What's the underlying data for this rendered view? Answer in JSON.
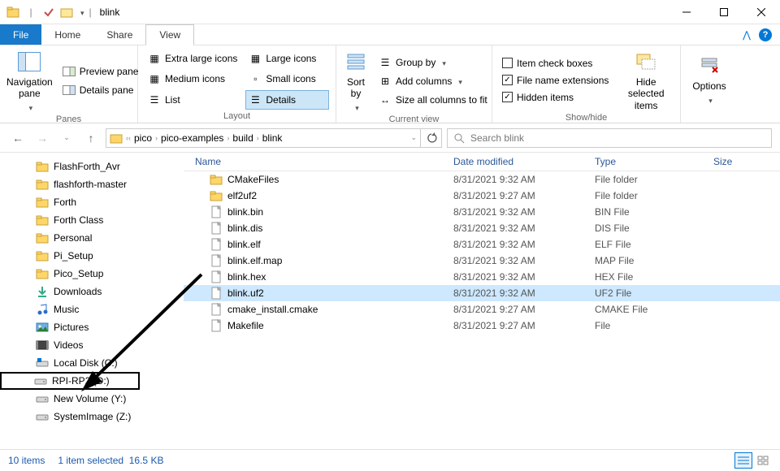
{
  "window": {
    "title": "blink"
  },
  "menubar": {
    "file": "File",
    "tabs": [
      "Home",
      "Share",
      "View"
    ],
    "active": 2
  },
  "ribbon": {
    "panes": {
      "label": "Panes",
      "nav": "Navigation pane",
      "preview": "Preview pane",
      "details": "Details pane"
    },
    "layout": {
      "label": "Layout",
      "xl": "Extra large icons",
      "lg": "Large icons",
      "md": "Medium icons",
      "sm": "Small icons",
      "list": "List",
      "details": "Details"
    },
    "current": {
      "label": "Current view",
      "sort": "Sort by",
      "group": "Group by",
      "addcols": "Add columns",
      "sizecols": "Size all columns to fit"
    },
    "showhide": {
      "label": "Show/hide",
      "itemcheck": "Item check boxes",
      "fileext": "File name extensions",
      "hidden": "Hidden items",
      "hidesel": "Hide selected items"
    },
    "options": "Options"
  },
  "breadcrumbs": [
    "pico",
    "pico-examples",
    "build",
    "blink"
  ],
  "search": {
    "placeholder": "Search blink"
  },
  "tree": [
    {
      "name": "FlashForth_Avr",
      "icon": "folder"
    },
    {
      "name": "flashforth-master",
      "icon": "folder"
    },
    {
      "name": "Forth",
      "icon": "folder"
    },
    {
      "name": "Forth Class",
      "icon": "folder"
    },
    {
      "name": "Personal",
      "icon": "folder"
    },
    {
      "name": "Pi_Setup",
      "icon": "folder"
    },
    {
      "name": "Pico_Setup",
      "icon": "folder"
    },
    {
      "name": "Downloads",
      "icon": "downloads"
    },
    {
      "name": "Music",
      "icon": "music"
    },
    {
      "name": "Pictures",
      "icon": "pictures"
    },
    {
      "name": "Videos",
      "icon": "videos"
    },
    {
      "name": "Local Disk (C:)",
      "icon": "drive-win"
    },
    {
      "name": "RPI-RP2 (D:)",
      "icon": "drive",
      "highlight": true
    },
    {
      "name": "New Volume (Y:)",
      "icon": "drive"
    },
    {
      "name": "SystemImage (Z:)",
      "icon": "drive"
    }
  ],
  "columns": {
    "name": "Name",
    "date": "Date modified",
    "type": "Type",
    "size": "Size"
  },
  "files": [
    {
      "name": "CMakeFiles",
      "date": "8/31/2021 9:32 AM",
      "type": "File folder",
      "icon": "folder"
    },
    {
      "name": "elf2uf2",
      "date": "8/31/2021 9:27 AM",
      "type": "File folder",
      "icon": "folder"
    },
    {
      "name": "blink.bin",
      "date": "8/31/2021 9:32 AM",
      "type": "BIN File",
      "icon": "file"
    },
    {
      "name": "blink.dis",
      "date": "8/31/2021 9:32 AM",
      "type": "DIS File",
      "icon": "file"
    },
    {
      "name": "blink.elf",
      "date": "8/31/2021 9:32 AM",
      "type": "ELF File",
      "icon": "file"
    },
    {
      "name": "blink.elf.map",
      "date": "8/31/2021 9:32 AM",
      "type": "MAP File",
      "icon": "file"
    },
    {
      "name": "blink.hex",
      "date": "8/31/2021 9:32 AM",
      "type": "HEX File",
      "icon": "file"
    },
    {
      "name": "blink.uf2",
      "date": "8/31/2021 9:32 AM",
      "type": "UF2 File",
      "icon": "file",
      "selected": true
    },
    {
      "name": "cmake_install.cmake",
      "date": "8/31/2021 9:27 AM",
      "type": "CMAKE File",
      "icon": "file"
    },
    {
      "name": "Makefile",
      "date": "8/31/2021 9:27 AM",
      "type": "File",
      "icon": "file"
    }
  ],
  "status": {
    "count": "10 items",
    "selection": "1 item selected",
    "size": "16.5 KB"
  }
}
